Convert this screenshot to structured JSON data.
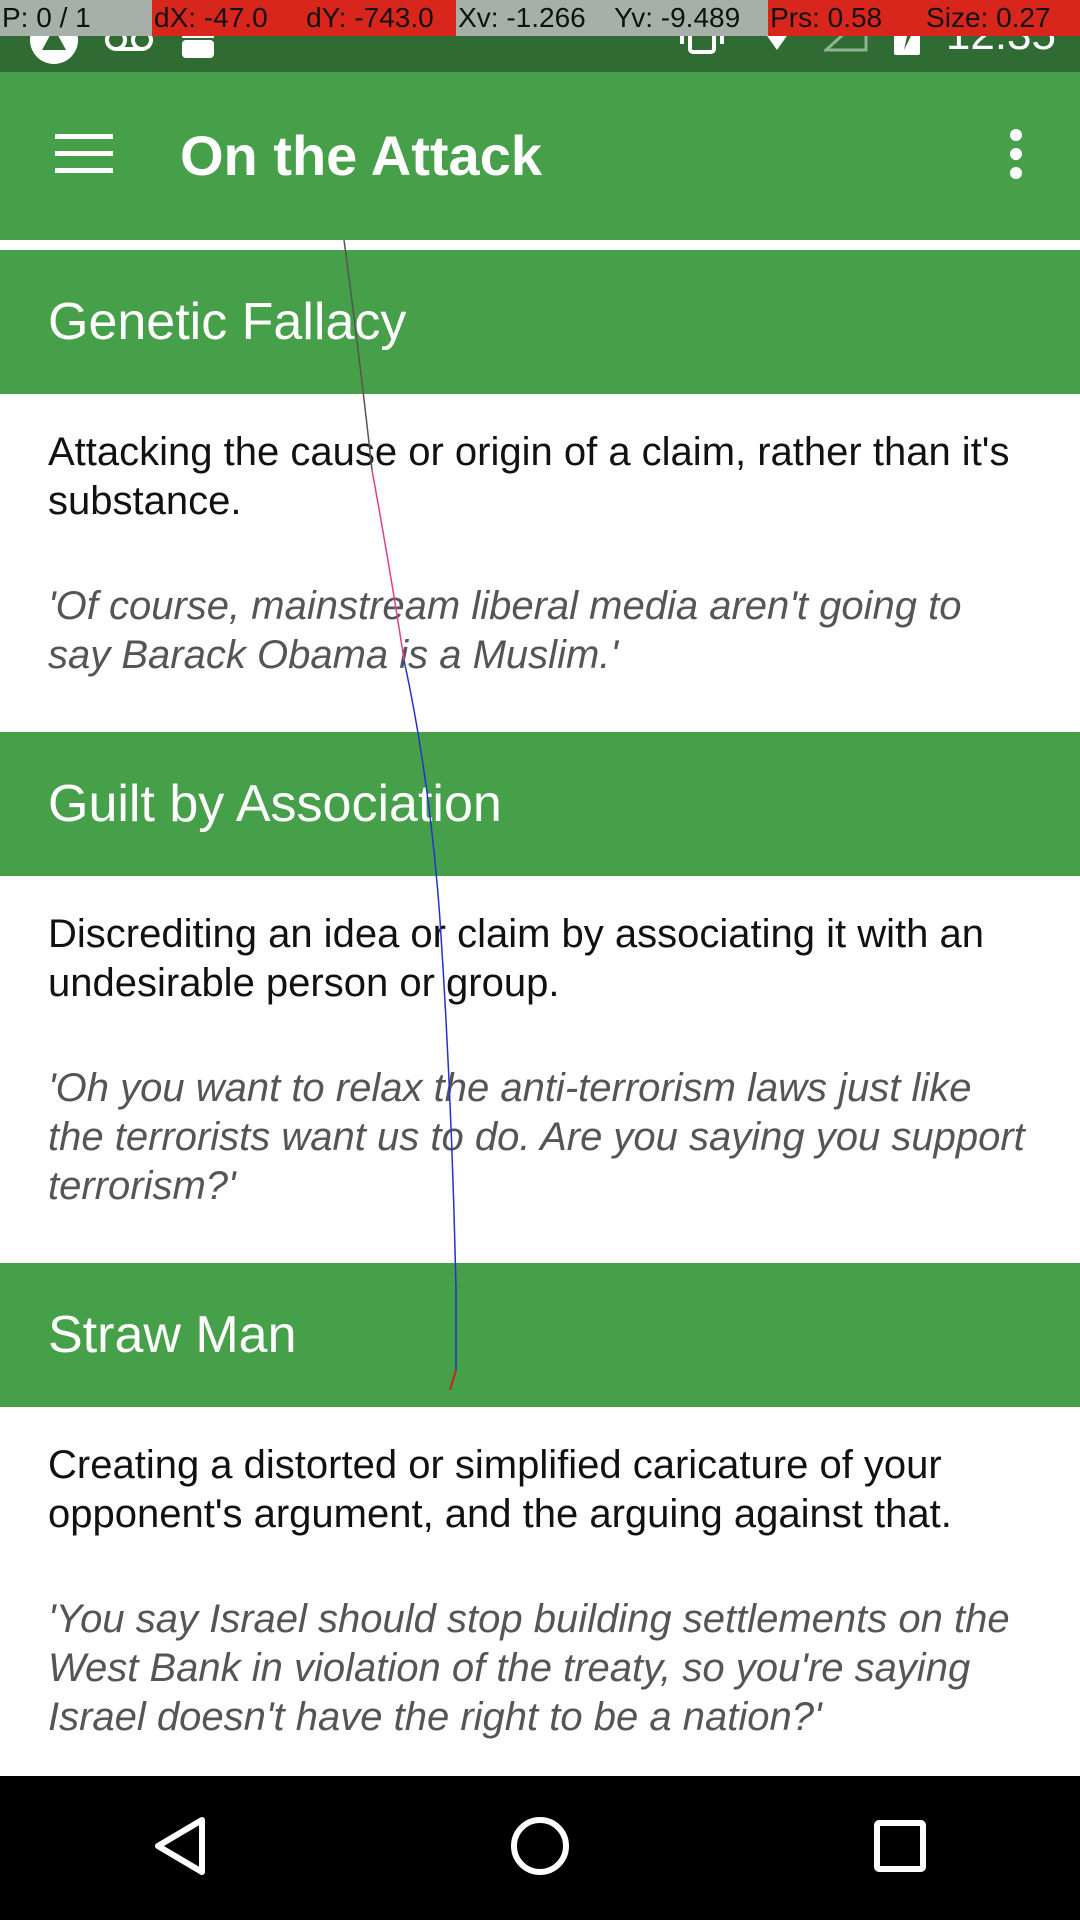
{
  "pointer_overlay": {
    "pointer": "P: 0 / 1",
    "dx": "dX: -47.0",
    "dy": "dY: -743.0",
    "xv": "Xv: -1.266",
    "yv": "Yv: -9.489",
    "prs": "Prs: 0.58",
    "size": "Size: 0.27"
  },
  "status_bar": {
    "time": "12:35",
    "icons": [
      "notification-app-icon",
      "voicemail-icon",
      "android-icon",
      "vibrate-icon",
      "wifi-icon",
      "signal-icon",
      "battery-charging-icon"
    ]
  },
  "app_bar": {
    "title": "On the Attack",
    "menu_icon": "hamburger-menu-icon",
    "more_icon": "more-vert-icon"
  },
  "sections": [
    {
      "title": "Genetic Fallacy",
      "definition": "Attacking the cause or origin of a claim, rather than it's substance.",
      "example": "'Of course, mainstream liberal media aren't going to say Barack Obama is a Muslim.'"
    },
    {
      "title": "Guilt by Association",
      "definition": "Discrediting an idea or claim by associating it with an undesirable person or group.",
      "example": "'Oh you want to relax the anti-terrorism laws just like the terrorists want us to do. Are you saying you support terrorism?'"
    },
    {
      "title": "Straw Man",
      "definition": "Creating a distorted or simplified caricature of your opponent's argument, and the arguing against that.",
      "example": "'You say Israel should stop building settlements on the West Bank in violation of the treaty, so you're saying Israel doesn't have the right to be a nation?'"
    }
  ],
  "nav_bar": {
    "back_icon": "back-triangle-icon",
    "home_icon": "home-circle-icon",
    "recents_icon": "recents-square-icon"
  },
  "colors": {
    "primary": "#46a049",
    "status_bar": "#2f6b33",
    "overlay_red": "#d9261c",
    "overlay_gray": "#a7b0a8"
  }
}
